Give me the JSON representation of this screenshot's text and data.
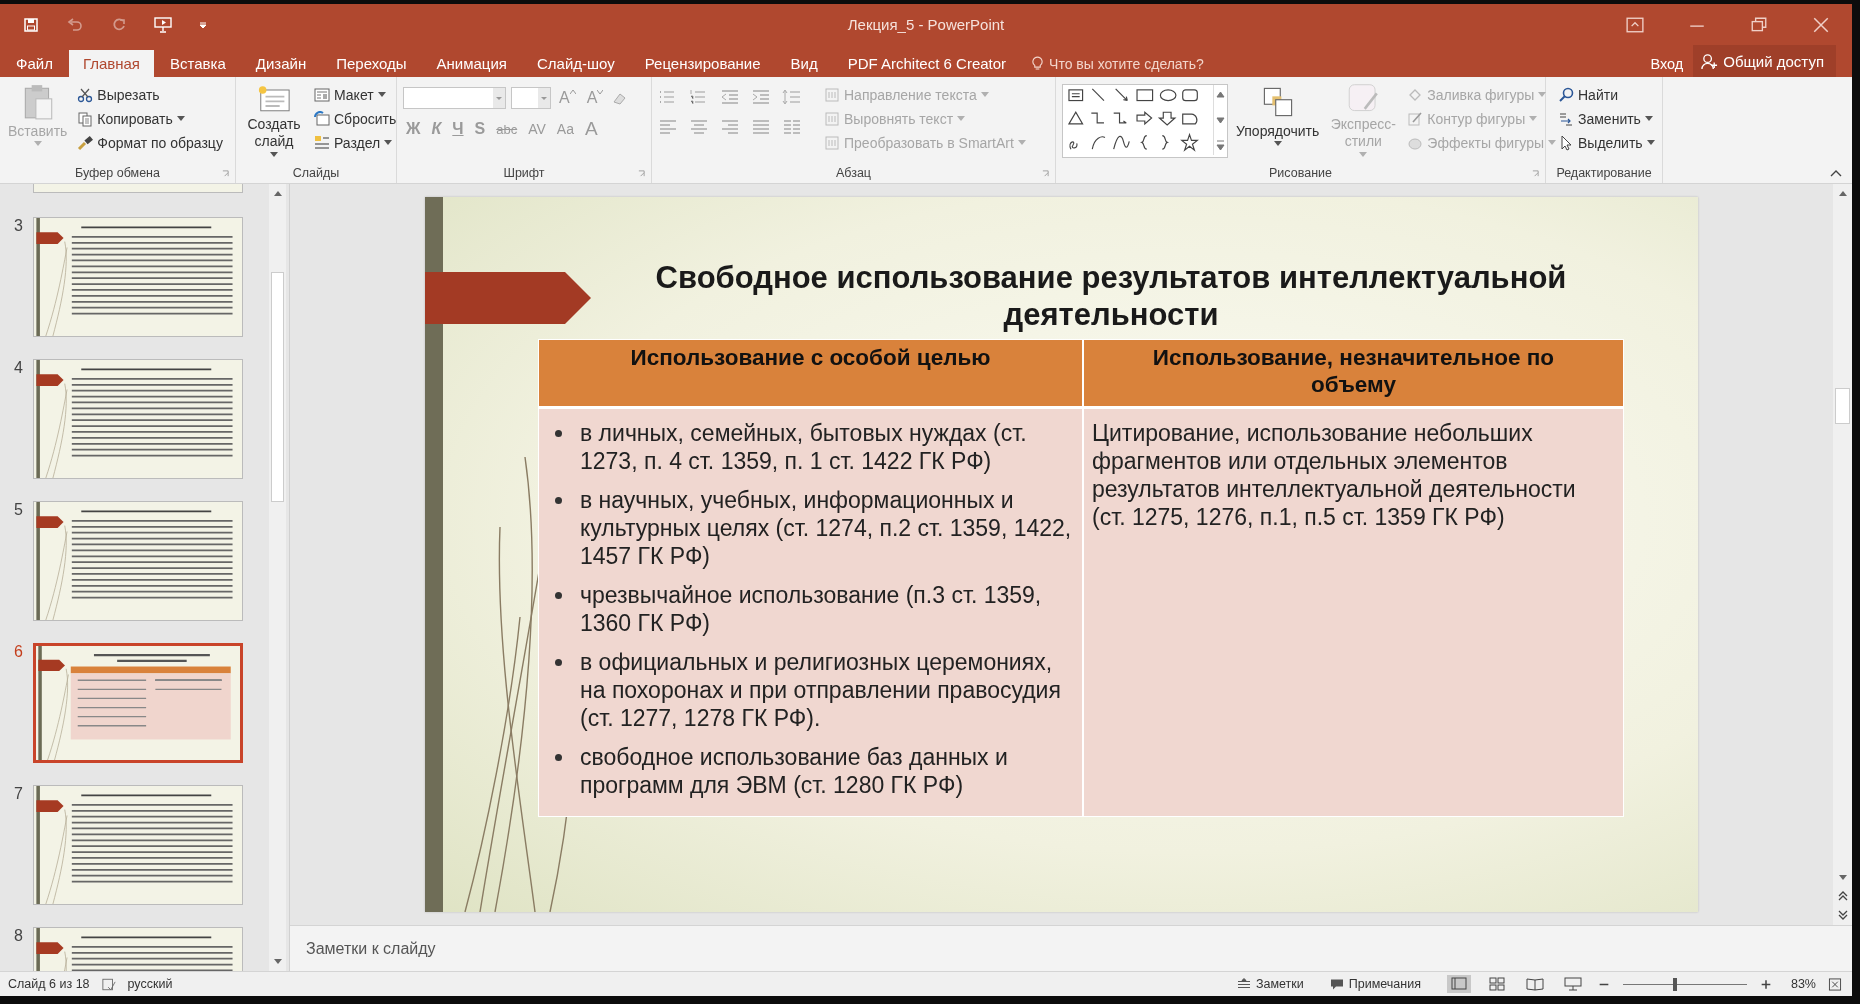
{
  "window": {
    "title": "Лекция_5 - PowerPoint"
  },
  "tabs": [
    {
      "label": "Файл",
      "selected": false
    },
    {
      "label": "Главная",
      "selected": true
    },
    {
      "label": "Вставка",
      "selected": false
    },
    {
      "label": "Дизайн",
      "selected": false
    },
    {
      "label": "Переходы",
      "selected": false
    },
    {
      "label": "Анимация",
      "selected": false
    },
    {
      "label": "Слайд-шоу",
      "selected": false
    },
    {
      "label": "Рецензирование",
      "selected": false
    },
    {
      "label": "Вид",
      "selected": false
    },
    {
      "label": "PDF Architect 6 Creator",
      "selected": false
    }
  ],
  "tell_me": {
    "placeholder": "Что вы хотите сделать?"
  },
  "sign_in": "Вход",
  "share": "Общий доступ",
  "ribbon": [
    {
      "kind": "clipboard",
      "title": "Буфер обмена",
      "items": [
        {
          "label": "Вставить",
          "disabled": true,
          "dropdown": true
        },
        {
          "label": "Вырезать",
          "disabled": false,
          "dropdown": false
        },
        {
          "label": "Копировать",
          "disabled": false,
          "dropdown": true
        },
        {
          "label": "Формат по образцу",
          "disabled": false,
          "dropdown": false
        }
      ]
    },
    {
      "kind": "slides",
      "title": "Слайды",
      "items": [
        {
          "label": "Создать слайд",
          "disabled": false,
          "dropdown": true
        },
        {
          "label": "Макет",
          "disabled": false,
          "dropdown": true
        },
        {
          "label": "Сбросить",
          "disabled": false,
          "dropdown": false
        },
        {
          "label": "Раздел",
          "disabled": false,
          "dropdown": true
        }
      ]
    },
    {
      "kind": "font",
      "title": "Шрифт",
      "disabled": true,
      "size_buttons": [
        "A",
        "A"
      ],
      "buttons": [
        "Ж",
        "К",
        "Ч",
        "S",
        "abc",
        "AV",
        "Aa",
        "A"
      ]
    },
    {
      "kind": "paragraph",
      "title": "Абзац",
      "items": [
        {
          "label": "Направление текста",
          "disabled": true,
          "dropdown": true
        },
        {
          "label": "Выровнять текст",
          "disabled": true,
          "dropdown": true
        },
        {
          "label": "Преобразовать в SmartArt",
          "disabled": true,
          "dropdown": true
        }
      ]
    },
    {
      "kind": "drawing",
      "title": "Рисование",
      "items": [
        {
          "label": "Упорядочить",
          "disabled": false,
          "dropdown": true
        },
        {
          "label": "Экспресс-стили",
          "disabled": true,
          "dropdown": true
        },
        {
          "label": "Заливка фигуры",
          "disabled": true,
          "dropdown": true
        },
        {
          "label": "Контур фигуры",
          "disabled": true,
          "dropdown": true
        },
        {
          "label": "Эффекты фигуры",
          "disabled": true,
          "dropdown": true
        }
      ]
    },
    {
      "kind": "editing",
      "title": "Редактирование",
      "items": [
        {
          "label": "Найти",
          "disabled": false,
          "dropdown": false
        },
        {
          "label": "Заменить",
          "disabled": false,
          "dropdown": true
        },
        {
          "label": "Выделить",
          "disabled": false,
          "dropdown": true
        }
      ]
    }
  ],
  "thumbnails": [
    {
      "number": "3",
      "kind": "text",
      "selected": false
    },
    {
      "number": "4",
      "kind": "text",
      "selected": false
    },
    {
      "number": "5",
      "kind": "text",
      "selected": false
    },
    {
      "number": "6",
      "kind": "table",
      "selected": true
    },
    {
      "number": "7",
      "kind": "text",
      "selected": false
    },
    {
      "number": "8",
      "kind": "text",
      "selected": false
    }
  ],
  "slide": {
    "title": "Свободное использование результатов интеллектуальной деятельности",
    "table": {
      "columns": [
        "Использование с особой целью",
        "Использование, незначительное по объему"
      ],
      "rows": [
        {
          "bullets": [
            "в личных, семейных, бытовых нуждах (ст. 1273, п. 4 ст. 1359, п. 1 ст. 1422 ГК РФ)",
            "в научных, учебных, информационных и культурных целях (ст. 1274, п.2 ст. 1359, 1422, 1457 ГК РФ)",
            "чрезвычайное использование (п.3 ст. 1359, 1360 ГК РФ)",
            "в официальных и религиозных церемониях, на похоронах и при отправлении правосудия (ст. 1277, 1278 ГК РФ).",
            "свободное использование баз данных и программ для ЭВМ (ст. 1280 ГК РФ)"
          ],
          "text": "Цитирование, использование небольших фрагментов или отдельных элементов результатов интеллектуальной деятельности (ст. 1275, 1276, п.1, п.5 ст. 1359 ГК РФ)"
        }
      ]
    }
  },
  "notes": {
    "placeholder": "Заметки к слайду"
  },
  "status_bar": {
    "slide_info": "Слайд 6 из 18",
    "language": "русский",
    "notes_button": "Заметки",
    "comments_button": "Примечания",
    "views": [
      {
        "kind": "normal",
        "selected": true
      },
      {
        "kind": "sorter",
        "selected": false
      },
      {
        "kind": "reading",
        "selected": false
      },
      {
        "kind": "show",
        "selected": false
      }
    ],
    "zoom": {
      "level": 0.42,
      "percent": "83%"
    }
  }
}
